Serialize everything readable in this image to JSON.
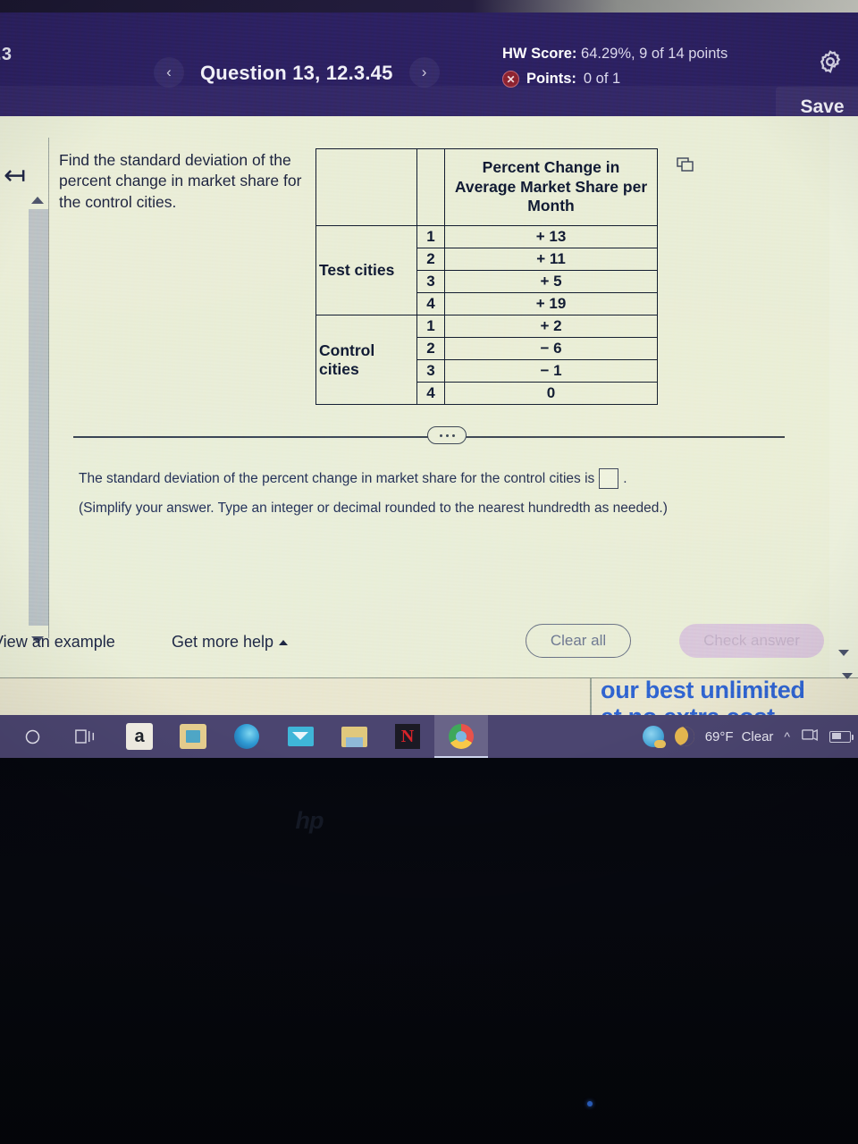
{
  "header": {
    "left_fragment": ".3",
    "prev_icon": "chevron-left-icon",
    "next_icon": "chevron-right-icon",
    "question_title": "Question 13, 12.3.45",
    "hw_score_label": "HW Score:",
    "hw_score_value": "64.29%, 9 of 14 points",
    "points_label": "Points:",
    "points_value": "0 of 1",
    "points_status_icon": "incorrect-x-icon",
    "settings_icon": "gear-icon",
    "save_label": "Save",
    "bg_color": "#2c2060"
  },
  "question": {
    "back_icon": "back-to-start-icon",
    "prompt": "Find the standard deviation of the percent change in market share for the control cities.",
    "copy_icon": "copy-to-clipboard-icon",
    "ellipsis_label": "•••"
  },
  "table": {
    "col_headers": [
      "",
      "",
      "Percent Change in Average Market Share per Month"
    ],
    "groups": [
      {
        "label": "Test cities",
        "rows": [
          {
            "index": "1",
            "value": "+ 13"
          },
          {
            "index": "2",
            "value": "+ 11"
          },
          {
            "index": "3",
            "value": "+ 5"
          },
          {
            "index": "4",
            "value": "+ 19"
          }
        ]
      },
      {
        "label": "Control cities",
        "rows": [
          {
            "index": "1",
            "value": "+ 2"
          },
          {
            "index": "2",
            "value": "− 6"
          },
          {
            "index": "3",
            "value": "− 1"
          },
          {
            "index": "4",
            "value": "0"
          }
        ]
      }
    ]
  },
  "answer": {
    "sentence_before": "The standard deviation of the percent change in market share for the control cities is",
    "sentence_after": ".",
    "input_value": "",
    "input_placeholder": "",
    "instruction": "(Simplify your answer. Type an integer or decimal rounded to the nearest hundredth as needed.)"
  },
  "actions": {
    "view_example": "View an example",
    "get_more_help": "Get more help",
    "get_more_help_caret": "caret-up-icon",
    "clear_all": "Clear all",
    "check_answer": "Check answer"
  },
  "ad": {
    "line1": "our best unlimited",
    "line2": "at no extra cost",
    "color": "#2f62d0"
  },
  "taskbar": {
    "items": [
      {
        "name": "search-icon",
        "glyph": "○"
      },
      {
        "name": "task-view-icon",
        "glyph": "☰"
      },
      {
        "name": "amazon-icon",
        "glyph": "a"
      },
      {
        "name": "microsoft-store-icon",
        "glyph": "▤"
      },
      {
        "name": "microsoft-edge-icon",
        "glyph": "◔"
      },
      {
        "name": "mail-icon",
        "glyph": "✉"
      },
      {
        "name": "file-explorer-icon",
        "glyph": "▬"
      },
      {
        "name": "netflix-icon",
        "glyph": "N"
      },
      {
        "name": "chrome-icon",
        "glyph": "◎"
      }
    ],
    "weather_icon": "partly-sunny-icon",
    "moon_icon": "crescent-moon-icon",
    "temperature": "69°F",
    "condition": "Clear",
    "show_hidden_icons": "chevron-up-icon",
    "device_icon": "display-cast-icon",
    "battery_icon": "battery-icon",
    "bg_color": "#4b4570"
  },
  "bezel": {
    "brand": "hp"
  }
}
